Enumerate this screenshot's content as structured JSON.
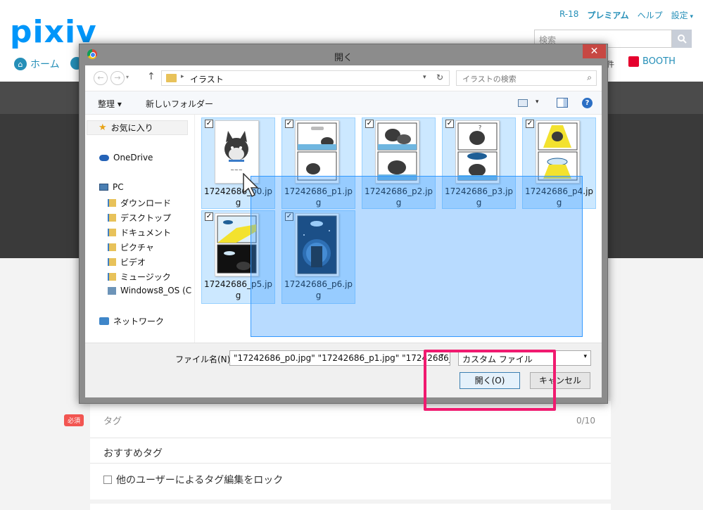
{
  "pixiv": {
    "logo": "pixiv",
    "links": [
      "R-18",
      "プレミアム",
      "ヘルプ",
      "設定"
    ],
    "search_placeholder": "検索",
    "nav_home": "ホーム",
    "nav_case": "件",
    "booth": "BOOTH",
    "required_badge": "必須",
    "tag_label": "タグ",
    "tag_count": "0/10",
    "recommended_tags": "おすすめタグ",
    "lock_tags": "他のユーザーによるタグ編集をロック"
  },
  "dialog": {
    "title": "開く",
    "close": "✕",
    "address": "イラスト",
    "search_placeholder": "イラストの検索",
    "toolbar": {
      "organize": "整理 ▾",
      "new_folder": "新しいフォルダー"
    },
    "nav": {
      "favorites": "お気に入り",
      "onedrive": "OneDrive",
      "pc": "PC",
      "pc_items": [
        "ダウンロード",
        "デスクトップ",
        "ドキュメント",
        "ピクチャ",
        "ビデオ",
        "ミュージック",
        "Windows8_OS (C"
      ],
      "network": "ネットワーク"
    },
    "files": [
      {
        "name": "17242686_p0.jpg",
        "checked": true
      },
      {
        "name": "17242686_p1.jpg",
        "checked": true
      },
      {
        "name": "17242686_p2.jpg",
        "checked": true
      },
      {
        "name": "17242686_p3.jpg",
        "checked": true
      },
      {
        "name": "17242686_p4.jpg",
        "checked": true
      },
      {
        "name": "17242686_p5.jpg",
        "checked": true
      },
      {
        "name": "17242686_p6.jpg",
        "checked": true
      }
    ],
    "filename_label": "ファイル名(N):",
    "filename_value": "\"17242686_p0.jpg\" \"17242686_p1.jpg\" \"17242686_",
    "file_type": "カスタム ファイル",
    "open_button": "開く(O)",
    "cancel_button": "キャンセル"
  },
  "colors": {
    "accent": "#0096fa",
    "highlight": "#f01a6f",
    "selection": "#cce8ff"
  }
}
